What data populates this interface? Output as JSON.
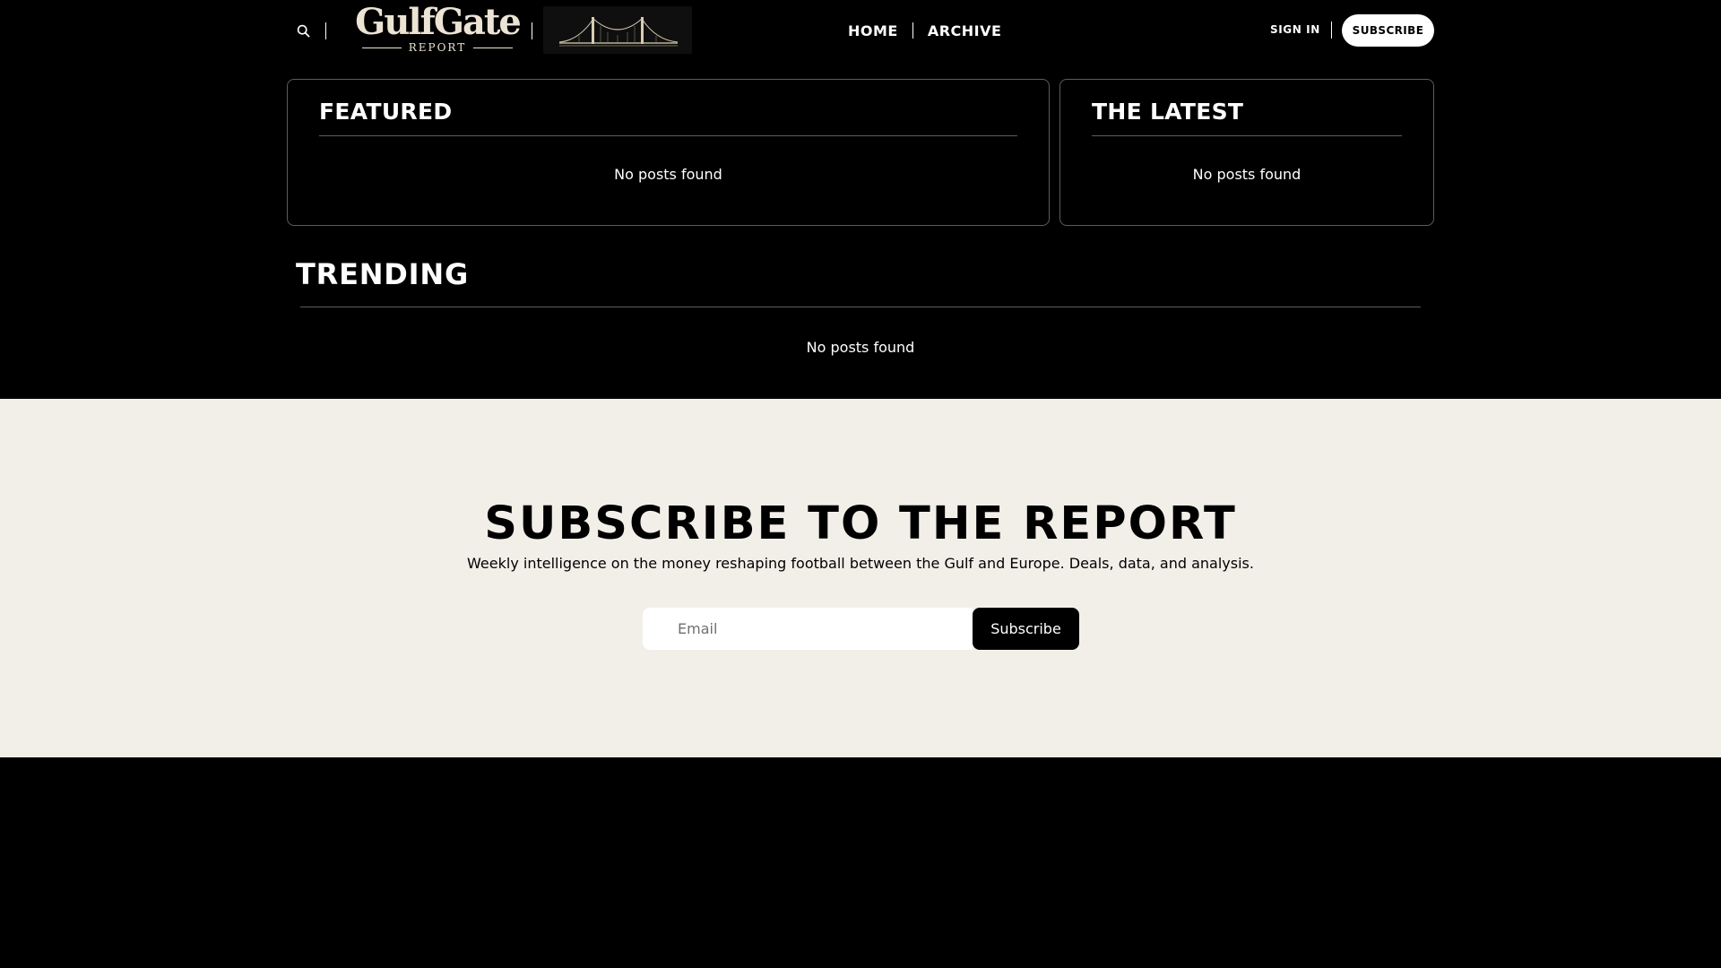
{
  "header": {
    "logo": {
      "main": "GulfGate",
      "sub": "REPORT"
    },
    "bridge_image": "suspension-bridge-illustration",
    "nav": [
      {
        "label": "HOME"
      },
      {
        "label": "ARCHIVE"
      }
    ],
    "sign_in": "SIGN IN",
    "subscribe": "SUBSCRIBE"
  },
  "featured": {
    "title": "FEATURED",
    "empty": "No posts found"
  },
  "latest": {
    "title": "THE LATEST",
    "empty": "No posts found"
  },
  "trending": {
    "title": "TRENDING",
    "empty": "No posts found"
  },
  "subscribe_section": {
    "title": "SUBSCRIBE TO THE REPORT",
    "description": "Weekly intelligence on the money reshaping football between the Gulf and Europe. Deals, data, and analysis.",
    "email_placeholder": "Email",
    "button": "Subscribe"
  },
  "colors": {
    "page_background": "#000000",
    "subscribe_background": "#f2efe9",
    "logo_cream": "#ebe3d3",
    "border": "#5c5c5c"
  }
}
